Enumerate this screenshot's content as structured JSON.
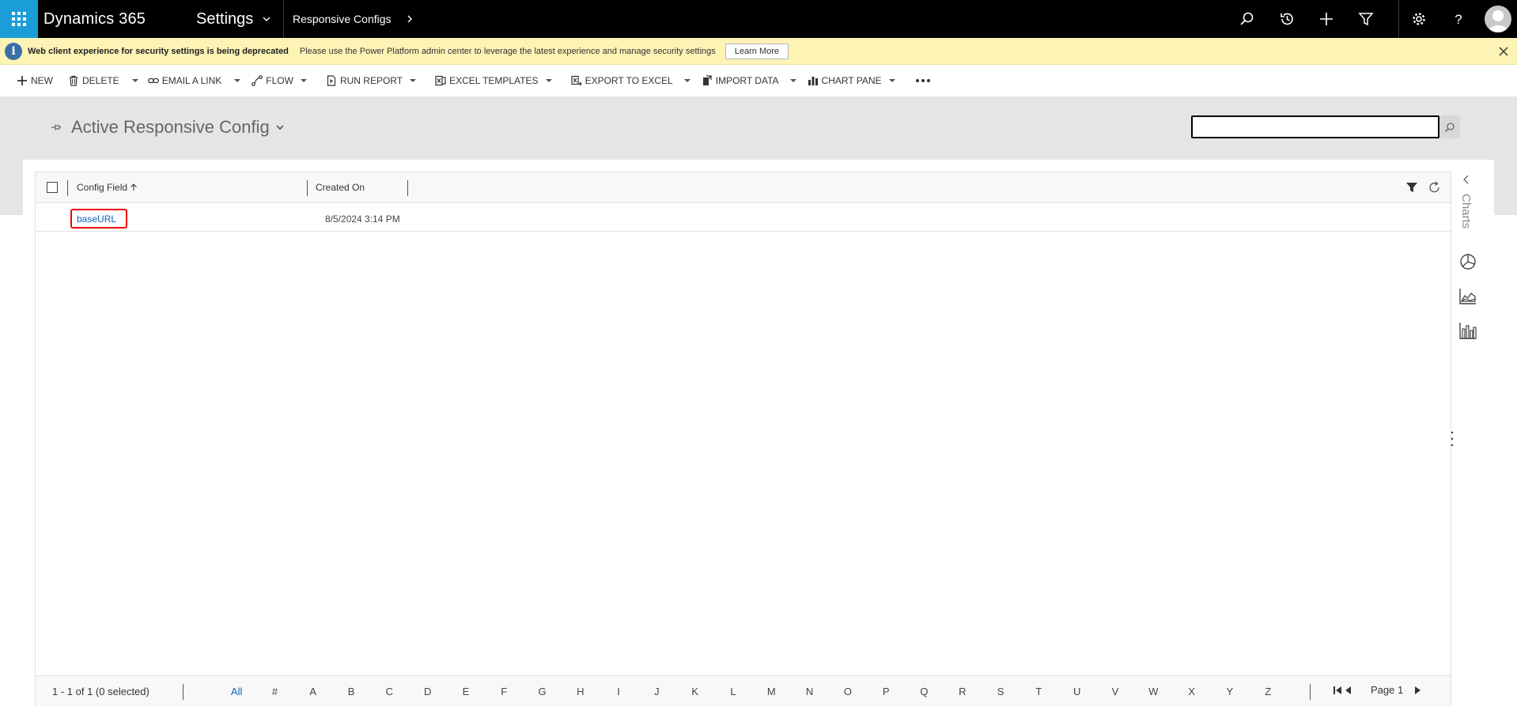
{
  "topbar": {
    "brand": "Dynamics 365",
    "area": "Settings",
    "breadcrumb": "Responsive Configs"
  },
  "notice": {
    "title": "Web client experience for security settings is being deprecated",
    "message": "Please use the Power Platform admin center to leverage the latest experience and manage security settings",
    "button": "Learn More"
  },
  "commands": {
    "new": "NEW",
    "delete": "DELETE",
    "email": "EMAIL A LINK",
    "flow": "FLOW",
    "run_report": "RUN REPORT",
    "excel_templates": "EXCEL TEMPLATES",
    "export_excel": "EXPORT TO EXCEL",
    "import_data": "IMPORT DATA",
    "chart_pane": "CHART PANE"
  },
  "view": {
    "title": "Active Responsive Config",
    "search_value": ""
  },
  "grid": {
    "columns": [
      "Config Field",
      "Created On"
    ],
    "rows": [
      {
        "config_field": "baseURL",
        "created_on": "8/5/2024 3:14 PM"
      }
    ]
  },
  "footer": {
    "count": "1 - 1 of 1 (0 selected)",
    "letters": [
      "All",
      "#",
      "A",
      "B",
      "C",
      "D",
      "E",
      "F",
      "G",
      "H",
      "I",
      "J",
      "K",
      "L",
      "M",
      "N",
      "O",
      "P",
      "Q",
      "R",
      "S",
      "T",
      "U",
      "V",
      "W",
      "X",
      "Y",
      "Z"
    ],
    "page": "Page 1"
  },
  "rail": {
    "label": "Charts"
  },
  "colors": {
    "waffle": "#1b9ed8",
    "link": "#1160b7",
    "highlight": "#e00000",
    "notice_bg": "#fcf3b5"
  }
}
